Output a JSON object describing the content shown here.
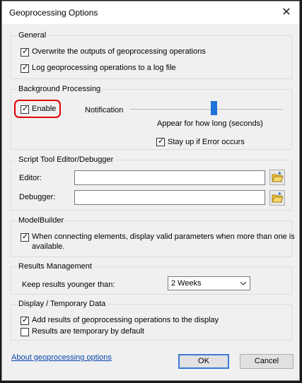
{
  "window": {
    "title": "Geoprocessing Options"
  },
  "general": {
    "label": "General",
    "overwrite_label": "Overwrite the outputs of geoprocessing operations",
    "log_label": "Log geoprocessing operations to a log file"
  },
  "background": {
    "label": "Background Processing",
    "enable_label": "Enable",
    "notification_label": "Notification",
    "appear_label": "Appear for how long (seconds)",
    "stay_label": "Stay up if Error occurs",
    "slider_value": 0.55
  },
  "script_tool": {
    "label": "Script Tool Editor/Debugger",
    "editor_label": "Editor:",
    "debugger_label": "Debugger:",
    "editor_value": "",
    "debugger_value": ""
  },
  "modelbuilder": {
    "label": "ModelBuilder",
    "valid_params_line1": "When connecting elements, display valid parameters when more than one is",
    "valid_params_line2": "available."
  },
  "results": {
    "label": "Results Management",
    "keep_label": "Keep results younger than:",
    "keep_value": "2 Weeks"
  },
  "display": {
    "label": "Display / Temporary Data",
    "add_results_label": "Add results of geoprocessing operations to the display",
    "temporary_label": "Results are temporary by default"
  },
  "footer": {
    "about_link": "About geoprocessing options",
    "ok_label": "OK",
    "cancel_label": "Cancel"
  },
  "colors": {
    "annotation_red": "#e00000",
    "focus_blue": "#3a7bd5",
    "link_blue": "#0645ad"
  },
  "icons": {
    "close": "close-icon",
    "browse": "open-folder-icon",
    "dropdown": "chevron-down-icon",
    "check": "checkmark"
  }
}
